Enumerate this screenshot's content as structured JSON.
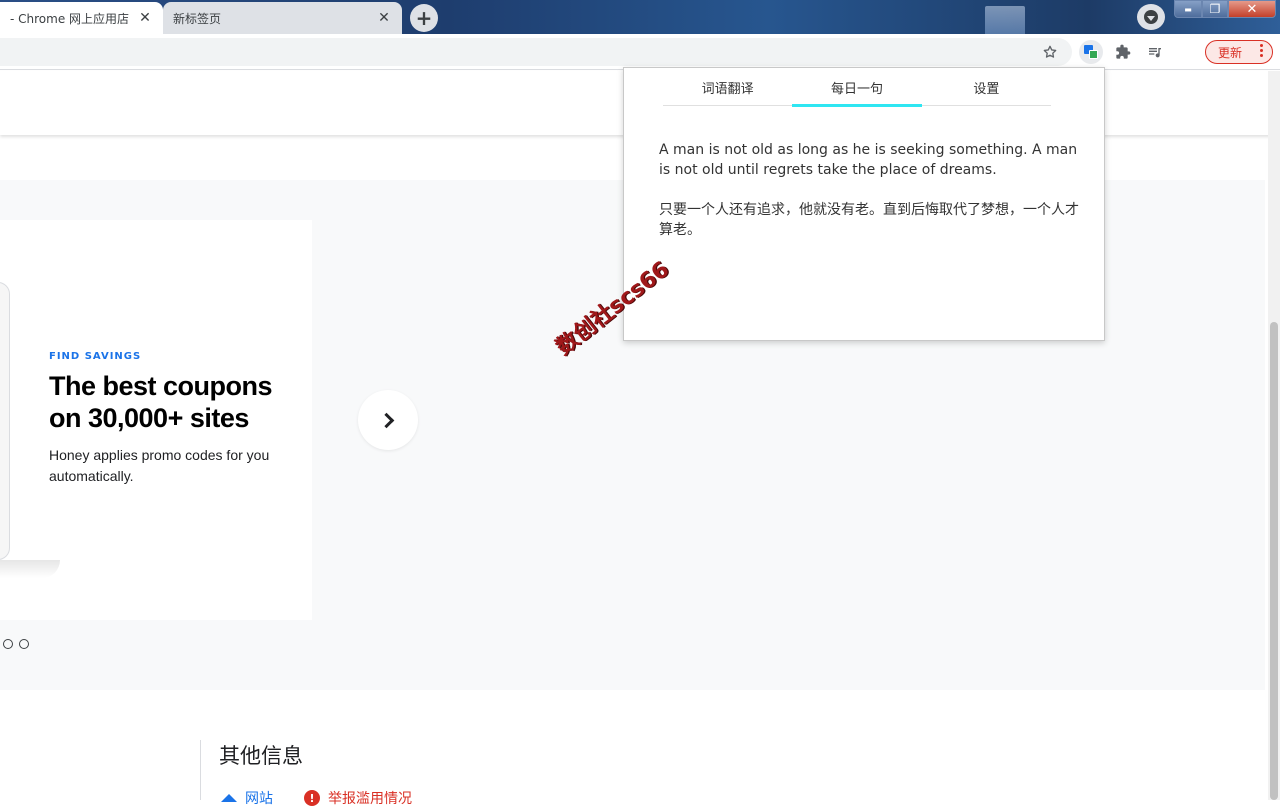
{
  "browser": {
    "tabs": [
      {
        "title": "- Chrome 网上应用店",
        "close": "✕"
      },
      {
        "title": "新标签页",
        "close": "✕"
      }
    ],
    "new_tab": "+",
    "window_controls": {
      "minimize": "▬",
      "maximize": "❐",
      "close": "✕"
    },
    "toolbar": {
      "bookmark_icon": "star-outline-icon",
      "translate_icon": "translate-extension-icon",
      "extensions_icon": "puzzle-icon",
      "media_icon": "media-playlist-icon",
      "update_label": "更新"
    }
  },
  "carousel": {
    "eyebrow": "FIND SAVINGS",
    "title": "The best coupons on 30,000+ sites",
    "description": "Honey applies promo codes for you automatically.",
    "dot_count": 2
  },
  "info": {
    "title": "其他信息",
    "website_label": "网站",
    "report_label": "举报滥用情况"
  },
  "popup": {
    "tabs": [
      {
        "label": "词语翻译"
      },
      {
        "label": "每日一句"
      },
      {
        "label": "设置"
      }
    ],
    "selected_tab": "每日一句",
    "accent_color": "#2ee6f2",
    "quote_en": "A man is not old as long as he is seeking something. A man is not old until regrets take the place of dreams.",
    "quote_zh": "只要一个人还有追求，他就没有老。直到后悔取代了梦想，一个人才算老。"
  },
  "watermark": "数创社scs66"
}
